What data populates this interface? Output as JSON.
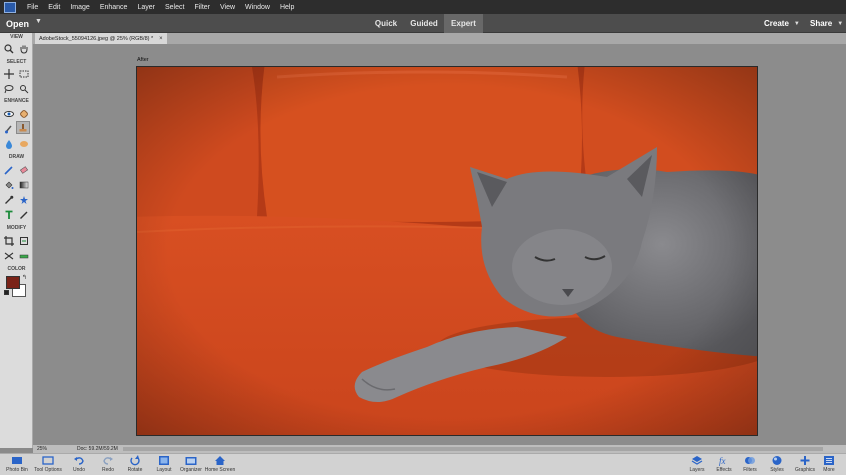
{
  "menubar": {
    "items": [
      "File",
      "Edit",
      "Image",
      "Enhance",
      "Layer",
      "Select",
      "Filter",
      "View",
      "Window",
      "Help"
    ]
  },
  "modebar": {
    "open_label": "Open",
    "tabs": [
      "Quick",
      "Guided",
      "Expert"
    ],
    "active_tab": "Expert",
    "create_label": "Create",
    "share_label": "Share"
  },
  "toolbox": {
    "sections": [
      "VIEW",
      "SELECT",
      "ENHANCE",
      "DRAW",
      "MODIFY",
      "COLOR"
    ]
  },
  "document": {
    "tab_title": "AdobeStock_55094126.jpeg @ 25% (RGB/8) *",
    "view_label": "After"
  },
  "status": {
    "zoom": "25%",
    "doc_size": "Doc: 59.2M/59.2M"
  },
  "bottombar": {
    "left": [
      "Photo Bin",
      "Tool Options",
      "Undo",
      "Redo",
      "Rotate",
      "Layout",
      "Organizer",
      "Home Screen"
    ],
    "right": [
      "Layers",
      "Effects",
      "Filters",
      "Styles",
      "Graphics",
      "More"
    ]
  },
  "colors": {
    "foreground": "#7a2318",
    "background": "#ffffff",
    "accent": "#2a64c8"
  }
}
